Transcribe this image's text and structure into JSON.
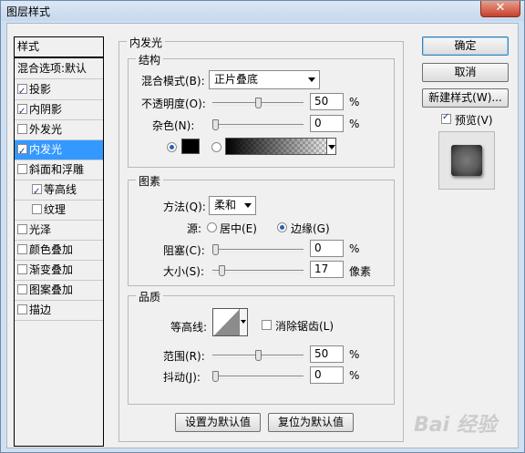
{
  "window": {
    "title": "图层样式",
    "close_glyph": "✕"
  },
  "styles_list": {
    "header": "样式",
    "blend_options": "混合选项:默认",
    "items": [
      {
        "label": "投影",
        "checked": true
      },
      {
        "label": "内阴影",
        "checked": true
      },
      {
        "label": "外发光",
        "checked": false
      },
      {
        "label": "内发光",
        "checked": true
      },
      {
        "label": "斜面和浮雕",
        "checked": false
      },
      {
        "label": "等高线",
        "checked": true
      },
      {
        "label": "纹理",
        "checked": false
      },
      {
        "label": "光泽",
        "checked": false
      },
      {
        "label": "颜色叠加",
        "checked": false
      },
      {
        "label": "渐变叠加",
        "checked": false
      },
      {
        "label": "图案叠加",
        "checked": false
      },
      {
        "label": "描边",
        "checked": false
      }
    ],
    "selected": "内发光"
  },
  "panel": {
    "title": "内发光",
    "structure": {
      "title": "结构",
      "blend_mode_label": "混合模式(B):",
      "blend_mode_value": "正片叠底",
      "opacity_label": "不透明度(O):",
      "opacity_value": "50",
      "opacity_unit": "%",
      "opacity_level": 0.5,
      "noise_label": "杂色(N):",
      "noise_value": "0",
      "noise_unit": "%",
      "noise_level": 0,
      "color_mode": "solid",
      "color_swatch": "#000000"
    },
    "elements": {
      "title": "图素",
      "method_label": "方法(Q):",
      "method_value": "柔和",
      "source_label": "源:",
      "source_center": "居中(E)",
      "source_edge": "边缘(G)",
      "source_selected": "edge",
      "choke_label": "阻塞(C):",
      "choke_value": "0",
      "choke_unit": "%",
      "choke_level": 0,
      "size_label": "大小(S):",
      "size_value": "17",
      "size_unit": "像素",
      "size_level": 0.07
    },
    "quality": {
      "title": "品质",
      "contour_label": "等高线:",
      "antialias_label": "消除锯齿(L)",
      "antialias_checked": false,
      "range_label": "范围(R):",
      "range_value": "50",
      "range_unit": "%",
      "range_level": 0.5,
      "jitter_label": "抖动(J):",
      "jitter_value": "0",
      "jitter_unit": "%",
      "jitter_level": 0
    },
    "make_default": "设置为默认值",
    "reset_default": "复位为默认值"
  },
  "actions": {
    "ok": "确定",
    "cancel": "取消",
    "new_style": "新建样式(W)...",
    "preview_label": "预览(V)",
    "preview_checked": true
  },
  "watermark": "Bai 经验"
}
